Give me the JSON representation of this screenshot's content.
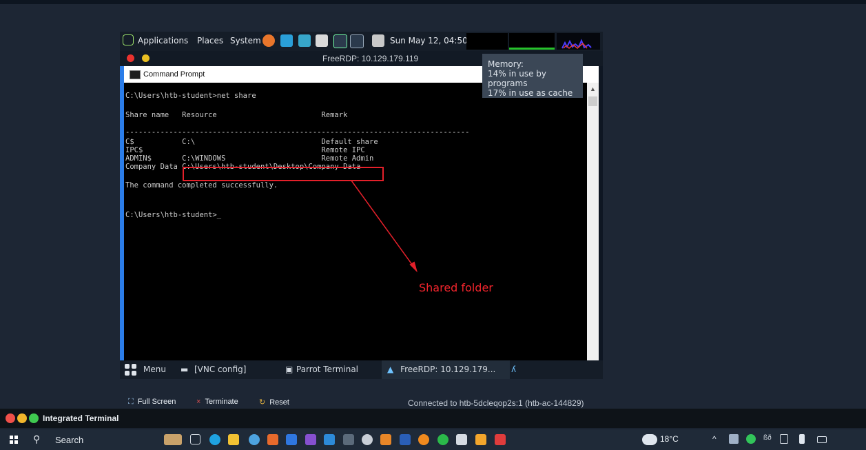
{
  "parrot_topbar": {
    "menu_applications": "Applications",
    "menu_places": "Places",
    "menu_system": "System",
    "clock": "Sun May 12, 04:50"
  },
  "rdp_window": {
    "title": "FreeRDP: 10.129.179.119"
  },
  "cmd_window": {
    "title": "Command Prompt",
    "lines": [
      "C:\\Users\\htb-student>net share",
      "Share name   Resource                        Remark",
      "-------------------------------------------------------------------------------",
      "C$           C:\\                             Default share",
      "IPC$                                         Remote IPC",
      "ADMIN$       C:\\WINDOWS                      Remote Admin",
      "Company Data C:\\Users\\htb-student\\Desktop\\Company Data",
      "The command completed successfully.",
      "C:\\Users\\htb-student>_"
    ]
  },
  "annotation": {
    "label": "Shared folder",
    "color": "#e4202a"
  },
  "memory_tooltip": {
    "heading": "Memory:",
    "line1": "14% in use by programs",
    "line2": "17% in use as cache"
  },
  "parrot_taskbar": {
    "menu": "Menu",
    "vnc_config": "[VNC config]",
    "parrot_terminal": "Parrot Terminal",
    "freerdp": "FreeRDP: 10.129.179..."
  },
  "vnc_controls": {
    "full_screen": "Full Screen",
    "terminate": "Terminate",
    "reset": "Reset",
    "connected": "Connected to htb-5dcleqop2s:1 (htb-ac-144829)"
  },
  "integrated_terminal": {
    "label": "Integrated Terminal"
  },
  "windows_taskbar": {
    "search": "Search",
    "temperature": "18°C"
  }
}
